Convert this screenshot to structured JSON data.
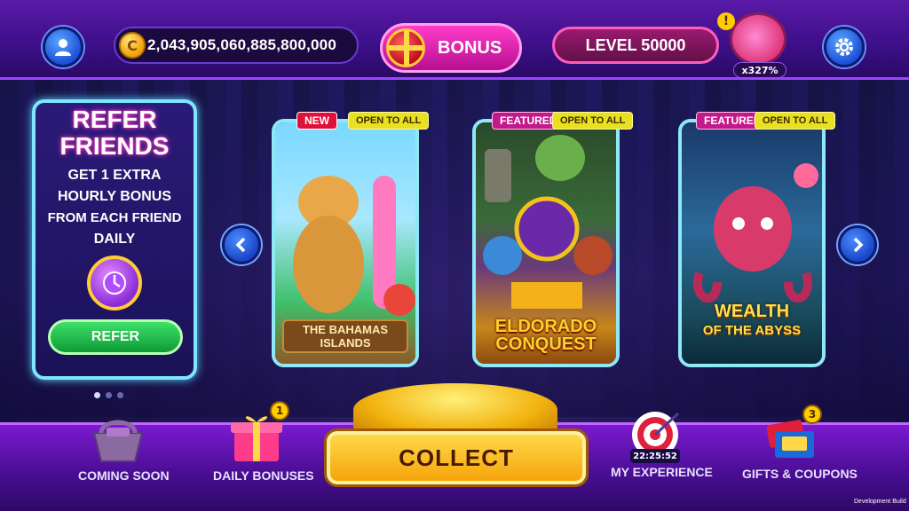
{
  "topbar": {
    "coins": "2,043,905,060,885,800,000",
    "bonus_label": "BONUS",
    "level_label": "LEVEL 50000",
    "piggy_bank_alert": "!",
    "piggy_multiplier": "x327%"
  },
  "refer_panel": {
    "title_line1": "REFER",
    "title_line2": "FRIENDS",
    "line1": "GET  1 EXTRA",
    "line2": "HOURLY BONUS",
    "line3": "FROM EACH FRIEND",
    "line4": "DAILY",
    "button_label": "REFER"
  },
  "games": [
    {
      "tag": "NEW",
      "tag_kind": "new",
      "access": "OPEN TO ALL",
      "title_line1": "THE BAHAMAS",
      "title_line2": "ISLANDS"
    },
    {
      "tag": "FEATURED",
      "tag_kind": "featured",
      "access": "OPEN TO ALL",
      "title_line1": "ELDORADO",
      "title_line2": "CONQUEST"
    },
    {
      "tag": "FEATURED",
      "tag_kind": "featured",
      "access": "OPEN TO ALL",
      "title_line1": "WEALTH",
      "title_line2": "OF THE ABYSS"
    }
  ],
  "bottombar": {
    "coming_soon": "COMING SOON",
    "daily_bonuses": "DAILY BONUSES",
    "daily_bonuses_badge": "1",
    "collect": "COLLECT",
    "experience_timer": "22:25:52",
    "my_experience": "MY EXPERIENCE",
    "gifts_coupons": "GIFTS & COUPONS",
    "gifts_badge": "3"
  },
  "footer": {
    "build": "Development Build"
  },
  "colors": {
    "accent_pink": "#ff3cc8",
    "accent_gold": "#ffd84a",
    "accent_cyan": "#8ee8f6",
    "refer_green": "#3ee06a"
  },
  "icons": [
    "profile-icon",
    "coin-icon",
    "gift-icon",
    "piggy-bank-icon",
    "settings-icon",
    "alarm-clock-icon",
    "chevron-left-icon",
    "chevron-right-icon",
    "basket-icon",
    "gift-box-icon",
    "target-icon",
    "coupon-icon"
  ]
}
